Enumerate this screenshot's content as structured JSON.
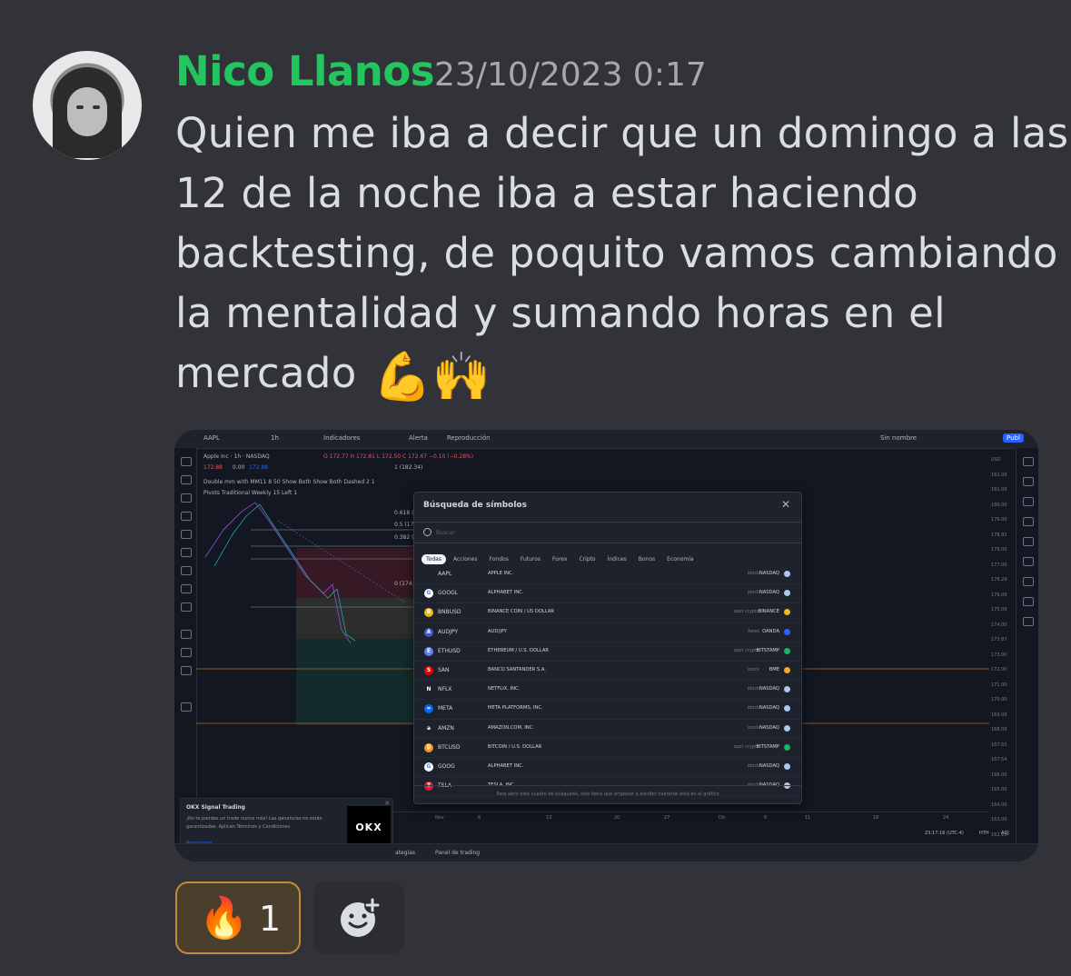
{
  "message": {
    "author": "Nico Llanos",
    "timestamp": "23/10/2023 0:17",
    "lines": [
      "Quien me iba a decir que un domingo a las",
      "12 de la noche iba a estar haciendo",
      "backtesting, de poquito vamos cambiando",
      "la mentalidad y sumando horas en el",
      "mercado"
    ],
    "emojis": "💪🙌"
  },
  "screenshot": {
    "toolbar": {
      "symbol": "AAPL",
      "interval": "1h",
      "indicators": "Indicadores",
      "alert": "Alerta",
      "replay": "Reproducción",
      "layout_name": "Sin nombre",
      "publish": "Publ"
    },
    "legend": {
      "title": "Apple Inc · 1h · NASDAQ",
      "ohlc": "O 172.77 H 172.81 L 172.50 C 172.67 −0.10 (−0.28%)",
      "price_a": "172.88",
      "price_b": "0.00",
      "price_c": "172.88",
      "indicator1": "Double mm with MM11 8 50 Show Both Show Both Dashed 2 1",
      "indicator2": "Pivots Traditional Weekly 15 Left 1",
      "fib1": "1 (182.34)",
      "fib2": "0.618 (",
      "fib3": "0.5 (178",
      "fib4": "0.382 (",
      "fib5": "0 (174.0"
    },
    "price_axis": [
      "USD",
      "182.00",
      "181.00",
      "180.00",
      "179.00",
      "178.92",
      "178.00",
      "177.00",
      "176.29",
      "176.00",
      "175.00",
      "174.00",
      "173.87",
      "173.00",
      "172.00",
      "171.00",
      "170.00",
      "169.00",
      "168.00",
      "167.65",
      "167.54",
      "166.00",
      "165.00",
      "164.00",
      "163.00",
      "162.10"
    ],
    "date_axis": [
      "Nov",
      "6",
      "13",
      "20",
      "27",
      "Dic",
      "6",
      "11",
      "18",
      "24"
    ],
    "bottom": {
      "tab1": "ategias",
      "tab2": "Panel de trading",
      "time": "23:17:16 (UTC-4)",
      "session": "HTH",
      "adj": "ADJ"
    },
    "ad": {
      "title": "OKX Signal Trading",
      "desc": "¡No te pierdas un trade nunca más! Las ganancias no están garantizadas. Aplican Términos y Condiciones",
      "logo": "OKX",
      "cta": "Registrarse"
    },
    "dialog": {
      "title": "Búsqueda de símbolos",
      "search_placeholder": "Buscar",
      "filters": [
        "Todas",
        "Acciones",
        "Fondos",
        "Futuros",
        "Forex",
        "Cripto",
        "Índices",
        "Bonos",
        "Economía"
      ],
      "rows": [
        {
          "sym": "AAPL",
          "desc": "APPLE INC.",
          "type": "stock",
          "exch": "NASDAQ",
          "logo": "",
          "logo_color": "#1e222d",
          "flag_color": "#b0c4f0"
        },
        {
          "sym": "GOOGL",
          "desc": "ALPHABET INC.",
          "type": "stock",
          "exch": "NASDAQ",
          "logo": "G",
          "logo_color": "#ffffff",
          "flag_color": "#b0c4f0"
        },
        {
          "sym": "BNBUSD",
          "desc": "BINANCE COIN / US DOLLAR",
          "type": "spot crypto",
          "exch": "BINANCE",
          "logo": "B",
          "logo_color": "#f0b90b",
          "flag_color": "#f0b90b"
        },
        {
          "sym": "AUDJPY",
          "desc": "AUD/JPY",
          "type": "forex",
          "exch": "OANDA",
          "logo": "A",
          "logo_color": "#3b5cc6",
          "flag_color": "#2962ff"
        },
        {
          "sym": "ETHUSD",
          "desc": "ETHEREUM / U.S. DOLLAR",
          "type": "spot crypto",
          "exch": "BITSTAMP",
          "logo": "E",
          "logo_color": "#627eea",
          "flag_color": "#1bb55c"
        },
        {
          "sym": "SAN",
          "desc": "BANCO SANTANDER S.A.",
          "type": "stock",
          "exch": "BME",
          "logo": "S",
          "logo_color": "#ec0000",
          "flag_color": "#f5a623"
        },
        {
          "sym": "NFLX",
          "desc": "NETFLIX, INC.",
          "type": "stock",
          "exch": "NASDAQ",
          "logo": "N",
          "logo_color": "#1e222d",
          "flag_color": "#b0c4f0"
        },
        {
          "sym": "META",
          "desc": "META PLATFORMS, INC.",
          "type": "stock",
          "exch": "NASDAQ",
          "logo": "∞",
          "logo_color": "#0866ff",
          "flag_color": "#b0c4f0"
        },
        {
          "sym": "AMZN",
          "desc": "AMAZON.COM, INC.",
          "type": "stock",
          "exch": "NASDAQ",
          "logo": "a",
          "logo_color": "#1e222d",
          "flag_color": "#b0c4f0"
        },
        {
          "sym": "BTCUSD",
          "desc": "BITCOIN / U.S. DOLLAR",
          "type": "spot crypto",
          "exch": "BITSTAMP",
          "logo": "₿",
          "logo_color": "#f7931a",
          "flag_color": "#1bb55c"
        },
        {
          "sym": "GOOG",
          "desc": "ALPHABET INC.",
          "type": "stock",
          "exch": "NASDAQ",
          "logo": "G",
          "logo_color": "#ffffff",
          "flag_color": "#b0c4f0"
        },
        {
          "sym": "TSLA",
          "desc": "TESLA, INC.",
          "type": "stock",
          "exch": "NASDAQ",
          "logo": "T",
          "logo_color": "#e31937",
          "flag_color": "#b0c4f0"
        }
      ],
      "footer": "Para abrir este cuadro de búsqueda, solo tiene que empezar a escribir mientras está en el gráfico"
    }
  },
  "reactions": [
    {
      "emoji": "🔥",
      "count": "1"
    }
  ],
  "colors": {
    "username": "#23c55e",
    "background": "#313338",
    "reaction_border": "#c78a3a"
  }
}
